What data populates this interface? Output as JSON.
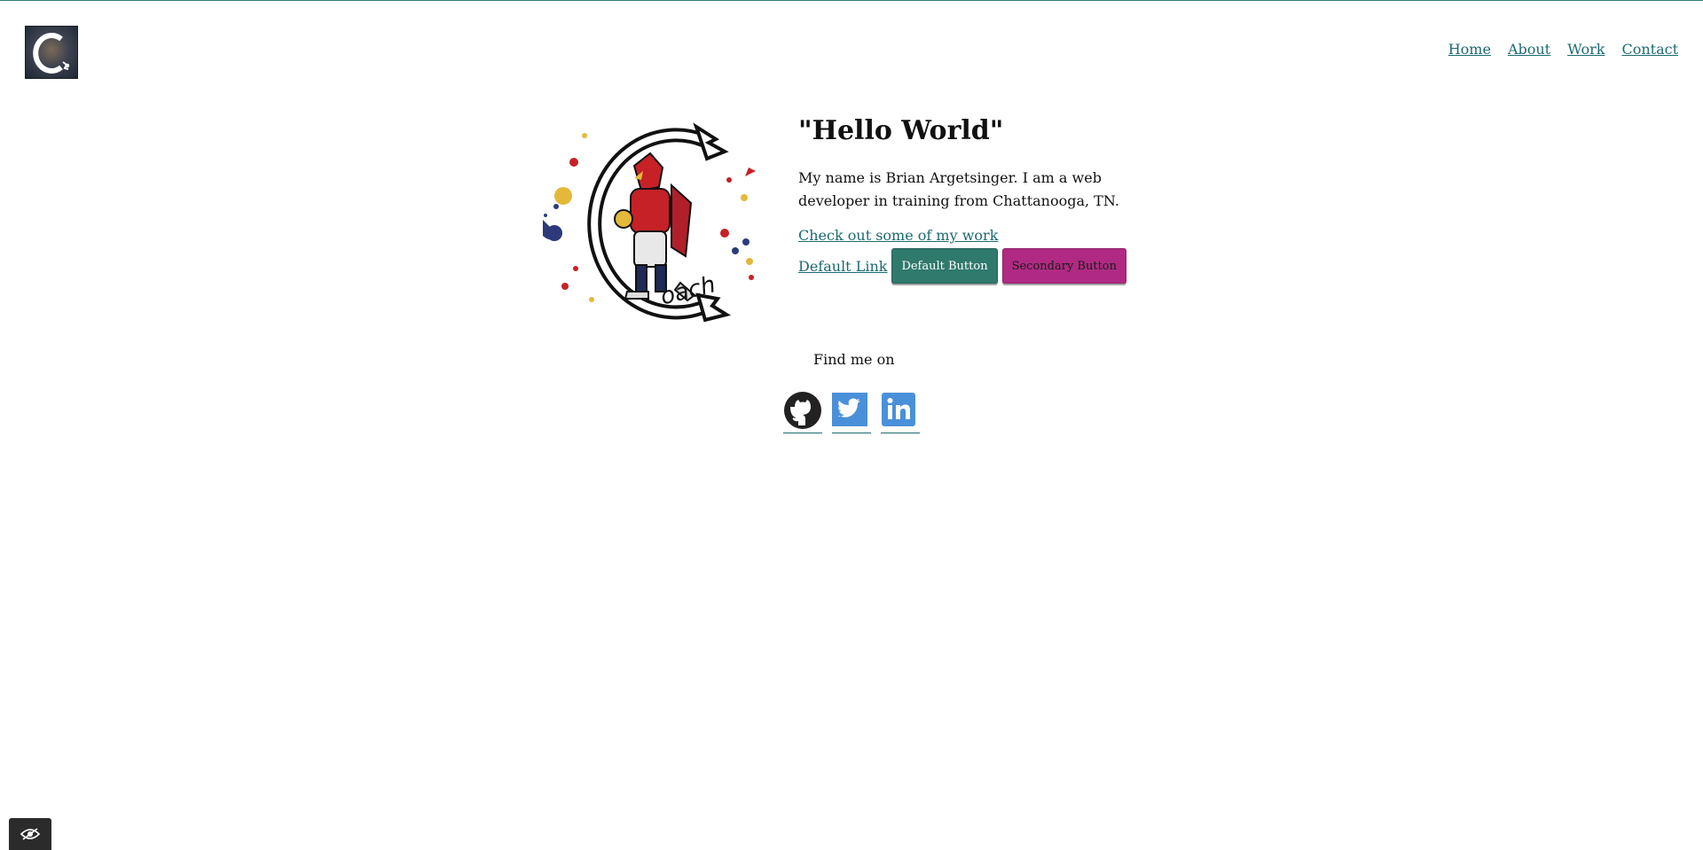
{
  "header": {
    "logo_alt": "C",
    "nav": [
      {
        "label": "Home"
      },
      {
        "label": "About"
      },
      {
        "label": "Work"
      },
      {
        "label": "Contact"
      }
    ]
  },
  "hero": {
    "image_text": "oach",
    "title": "\"Hello World\"",
    "bio": "My name is Brian Argetsinger. I am a web developer in training from Chattanooga, TN.",
    "work_link": "Check out some of my work",
    "default_link": "Default Link",
    "default_button": "Default Button",
    "secondary_button": "Secondary Button"
  },
  "social": {
    "heading": "Find me on",
    "links": [
      {
        "icon": "github-icon"
      },
      {
        "icon": "twitter-icon"
      },
      {
        "icon": "linkedin-icon"
      }
    ]
  },
  "colors": {
    "accent": "#1b6a70",
    "primary_button": "#2f7a6d",
    "secondary_button": "#b02a83",
    "social_blue": "#4a90d9"
  }
}
